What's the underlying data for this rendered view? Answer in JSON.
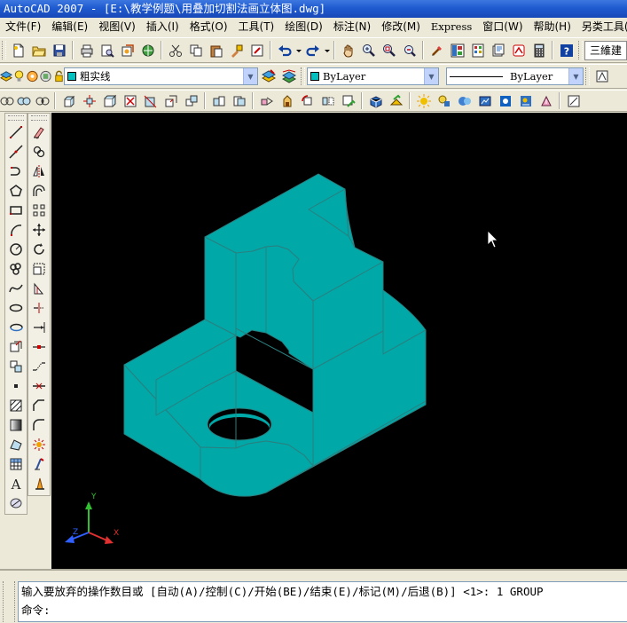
{
  "window": {
    "title": "AutoCAD 2007 - [E:\\教学例题\\用叠加切割法画立体图.dwg]"
  },
  "menu": [
    "文件(F)",
    "编辑(E)",
    "视图(V)",
    "插入(I)",
    "格式(O)",
    "工具(T)",
    "绘图(D)",
    "标注(N)",
    "修改(M)",
    "Express",
    "窗口(W)",
    "帮助(H)",
    "另类工具(F)"
  ],
  "toolbar": {
    "workspace": "三維建模",
    "layer_name": "粗实线",
    "color_value": "ByLayer",
    "linetype_value": "ByLayer",
    "layer_color": "#00c0c0",
    "color_swatch": "#00c0c0"
  },
  "command": {
    "history_line": "输入要放弃的操作数目或 [自动(A)/控制(C)/开始(BE)/结束(E)/标记(M)/后退(B)] <1>: 1 GROUP",
    "prompt": "命令:"
  },
  "ucs": {
    "x_label": "X",
    "y_label": "Y",
    "z_label": "Z",
    "x_color": "#e03030",
    "y_color": "#30c030",
    "z_color": "#3060ff"
  },
  "model": {
    "face_color": "#00a8a8",
    "edge_color": "#2a8080"
  },
  "icons": {
    "toolbar1": [
      "new-icon",
      "open-icon",
      "save-icon",
      "print-icon",
      "plot-preview-icon",
      "publish-icon",
      "3d-dwf-icon",
      "cut-icon",
      "copy-icon",
      "paste-icon",
      "match-properties-icon",
      "block-editor-icon",
      "undo-icon",
      "redo-icon",
      "pan-icon",
      "zoom-realtime-icon",
      "zoom-window-icon",
      "zoom-previous-icon",
      "properties-icon",
      "design-center-icon",
      "tool-palettes-icon",
      "sheet-set-icon",
      "markup-icon",
      "calculator-icon",
      "help-icon"
    ],
    "toolbar3": [
      "box-icon",
      "sphere-icon",
      "cylinder-icon",
      "cone-icon",
      "wedge-icon",
      "torus-icon",
      "extrude-icon",
      "revolve-icon",
      "sweep-icon",
      "loft-icon",
      "union-icon",
      "subtract-icon",
      "intersect-icon",
      "3d-align-icon",
      "3d-move-icon",
      "3d-rotate-icon",
      "section-plane-icon",
      "3d-orbit-icon",
      "hide-icon",
      "visual-styles-icon"
    ],
    "draw": [
      "line-icon",
      "construction-line-icon",
      "polyline-icon",
      "polygon-icon",
      "rectangle-icon",
      "arc-icon",
      "circle-icon",
      "revision-cloud-icon",
      "spline-icon",
      "ellipse-icon",
      "ellipse-arc-icon",
      "insert-block-icon",
      "make-block-icon",
      "point-icon",
      "hatch-icon",
      "gradient-icon",
      "region-icon",
      "table-icon",
      "multiline-text-icon",
      "add-selected-icon"
    ],
    "modify": [
      "erase-icon",
      "copy-object-icon",
      "mirror-icon",
      "offset-icon",
      "array-icon",
      "move-icon",
      "rotate-icon",
      "scale-icon",
      "stretch-icon",
      "trim-icon",
      "extend-icon",
      "break-at-point-icon",
      "break-icon",
      "join-icon",
      "chamfer-icon",
      "fillet-icon",
      "explode-icon",
      "text-style-icon",
      "pen-icon"
    ]
  }
}
